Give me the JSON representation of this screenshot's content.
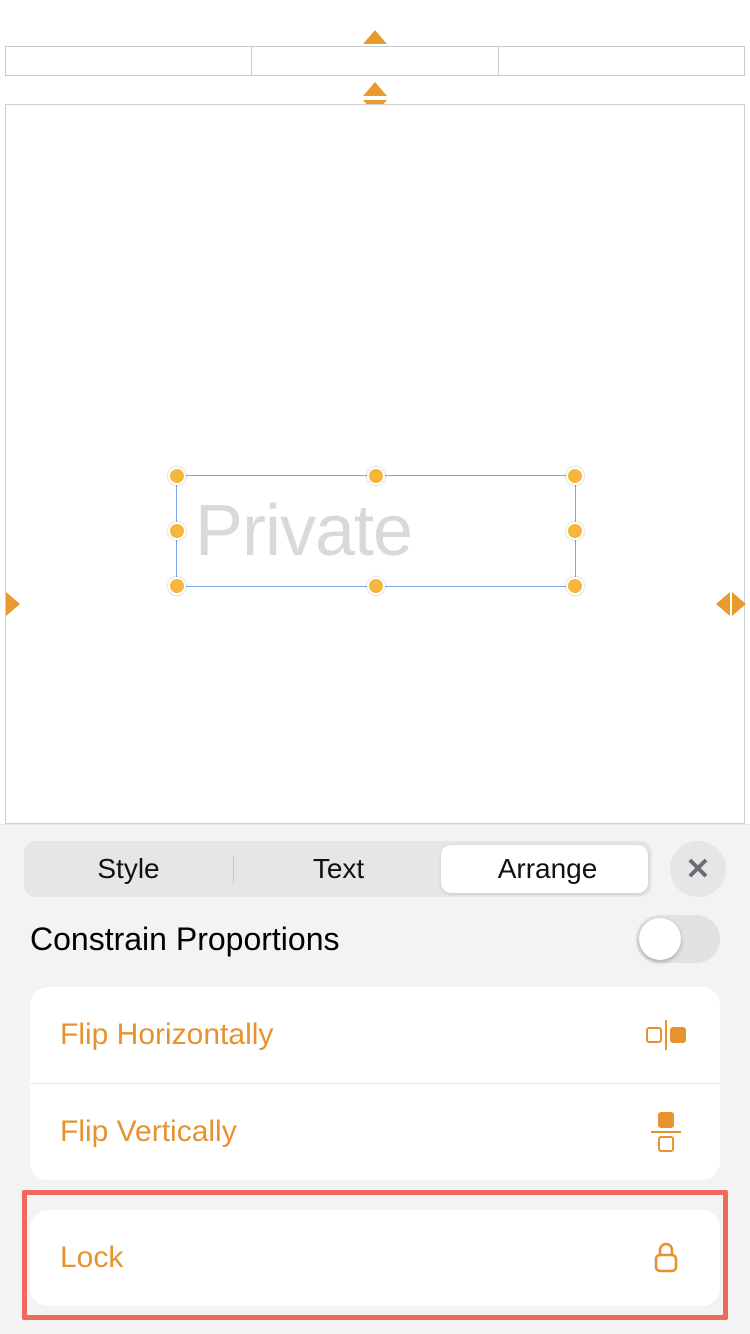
{
  "canvas": {
    "selected_text": "Private"
  },
  "panel": {
    "tabs": {
      "style": "Style",
      "text": "Text",
      "arrange": "Arrange"
    },
    "constrain_label": "Constrain Proportions",
    "constrain_on": false,
    "actions": {
      "flip_h": "Flip Horizontally",
      "flip_v": "Flip Vertically",
      "lock": "Lock"
    }
  }
}
